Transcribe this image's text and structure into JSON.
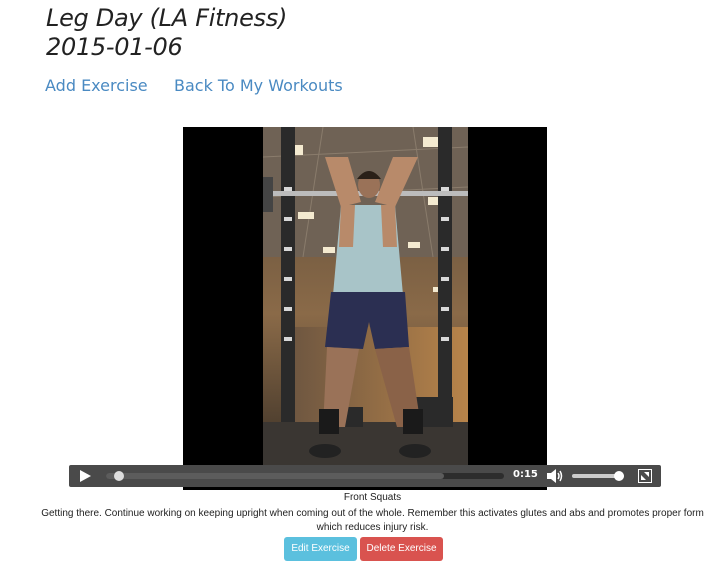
{
  "workout": {
    "title": "Leg Day (LA Fitness)",
    "date": "2015-01-06"
  },
  "nav": {
    "add_exercise": "Add Exercise",
    "back_to_workouts": "Back To My Workouts"
  },
  "player": {
    "current_time": "0:15",
    "progress": 0.02,
    "buffered": 0.85,
    "volume": 0.9,
    "icons": [
      "play-icon",
      "volume-icon",
      "fullscreen-icon"
    ]
  },
  "exercise": {
    "name": "Front Squats",
    "notes": "Getting there. Continue working on keeping upright when coming out of the whole. Remember this activates glutes and abs and promotes proper form which reduces injury risk."
  },
  "actions": {
    "edit": "Edit Exercise",
    "delete": "Delete Exercise"
  },
  "colors": {
    "link": "#4a8ac2",
    "edit_button": "#5bc0de",
    "delete_button": "#d9534f",
    "controls_bg": "#4a4a4a"
  }
}
